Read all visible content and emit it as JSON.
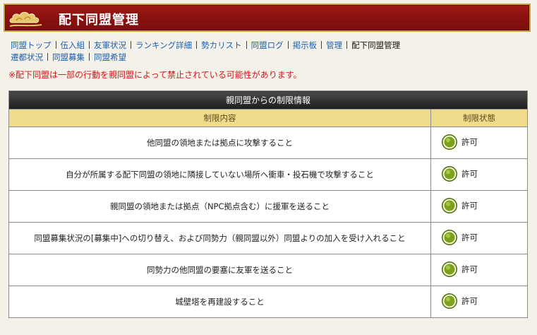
{
  "header": {
    "title": "配下同盟管理"
  },
  "nav": {
    "row1": [
      {
        "label": "同盟トップ",
        "current": false
      },
      {
        "label": "伍入組",
        "current": false
      },
      {
        "label": "友軍状況",
        "current": false
      },
      {
        "label": "ランキング詳細",
        "current": false
      },
      {
        "label": "勢カリスト",
        "current": false
      },
      {
        "label": "同盟ログ",
        "current": false
      },
      {
        "label": "掲示板",
        "current": false
      },
      {
        "label": "管理",
        "current": false
      },
      {
        "label": "配下同盟管理",
        "current": true
      }
    ],
    "row2": [
      {
        "label": "遷都状況"
      },
      {
        "label": "同盟募集"
      },
      {
        "label": "同盟希望"
      }
    ]
  },
  "warning": "※配下同盟は一部の行動を親同盟によって禁止されている可能性があります。",
  "table": {
    "caption": "親同盟からの制限情報",
    "headers": {
      "content": "制限内容",
      "status": "制限状態"
    },
    "rows": [
      {
        "content": "他同盟の領地または拠点に攻撃すること",
        "status": "許可"
      },
      {
        "content": "自分が所属する配下同盟の領地に隣接していない場所へ衝車・投石機で攻撃すること",
        "status": "許可"
      },
      {
        "content": "親同盟の領地または拠点（NPC拠点含む）に援軍を送ること",
        "status": "許可"
      },
      {
        "content": "同盟募集状況の[募集中]への切り替え、および同勢力（親同盟以外）同盟よりの加入を受け入れること",
        "status": "許可"
      },
      {
        "content": "同勢力の他同盟の要塞に友軍を送ること",
        "status": "許可"
      },
      {
        "content": "城壁塔を再建設すること",
        "status": "許可"
      }
    ]
  },
  "colors": {
    "header_bg": "#8a1210",
    "link": "#1b5fb0",
    "warning": "#d4161a",
    "table_head": "#efdc8c",
    "status_icon": "#6a8a12"
  },
  "icons": {
    "logo": "cloud-logo-icon",
    "status": "green-circle-icon"
  }
}
